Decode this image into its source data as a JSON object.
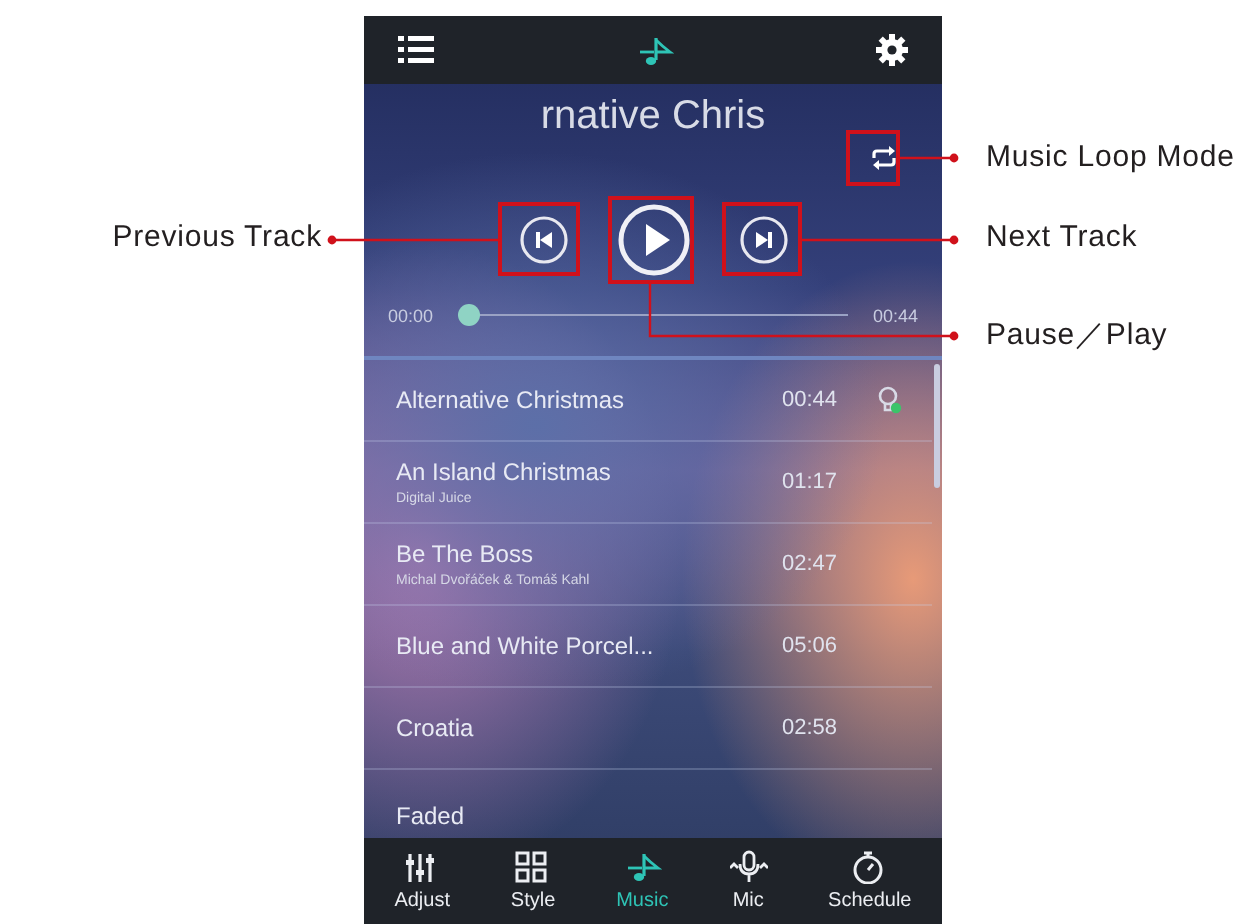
{
  "player": {
    "title": "rnative Chris",
    "elapsed": "00:00",
    "total": "00:44",
    "progress": {
      "level": 0
    }
  },
  "tracks": [
    {
      "title": "Alternative Christmas",
      "duration": "00:44",
      "current": true
    },
    {
      "title": "An Island Christmas",
      "artist": "Digital Juice",
      "duration": "01:17",
      "current": false
    },
    {
      "title": "Be The Boss",
      "artist": "Michal Dvořáček & Tomáš Kahl",
      "duration": "02:47",
      "current": false
    },
    {
      "title": "Blue and White Porcel...",
      "duration": "05:06",
      "current": false
    },
    {
      "title": "Croatia",
      "duration": "02:58",
      "current": false
    },
    {
      "title": "Faded",
      "current": false
    }
  ],
  "nav": [
    {
      "label": "Adjust",
      "kind": "sliders",
      "selected": false
    },
    {
      "label": "Style",
      "kind": "grid",
      "selected": false
    },
    {
      "label": "Music",
      "kind": "note",
      "selected": true
    },
    {
      "label": "Mic",
      "kind": "mic",
      "selected": false
    },
    {
      "label": "Schedule",
      "kind": "timer",
      "selected": false
    }
  ],
  "annotations": [
    {
      "label": "Music Loop Mode"
    },
    {
      "label": "Previous Track"
    },
    {
      "label": "Next Track"
    },
    {
      "label": "Pause／Play"
    }
  ]
}
